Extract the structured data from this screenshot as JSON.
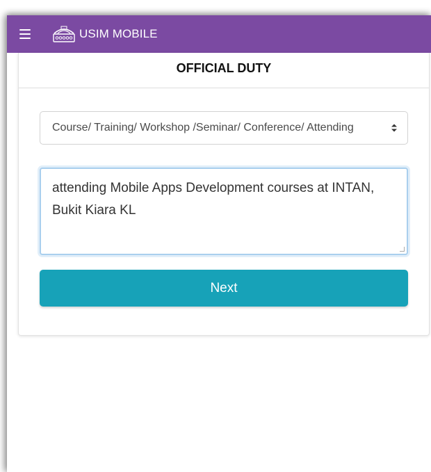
{
  "app": {
    "title": "USIM MOBILE",
    "brand_color": "#7b4aa2"
  },
  "icons": {
    "menu": "hamburger-menu-icon",
    "logo": "usim-logo-icon",
    "select_arrows": "up-down-chevron-icon"
  },
  "page": {
    "heading": "OFFICIAL DUTY"
  },
  "form": {
    "category_select": {
      "selected": "Course/ Training/ Workshop /Seminar/ Conference/ Attending"
    },
    "description": {
      "value": "attending Mobile Apps Development courses at INTAN, Bukit Kiara KL"
    },
    "next_label": "Next",
    "button_color": "#17a2b8"
  }
}
